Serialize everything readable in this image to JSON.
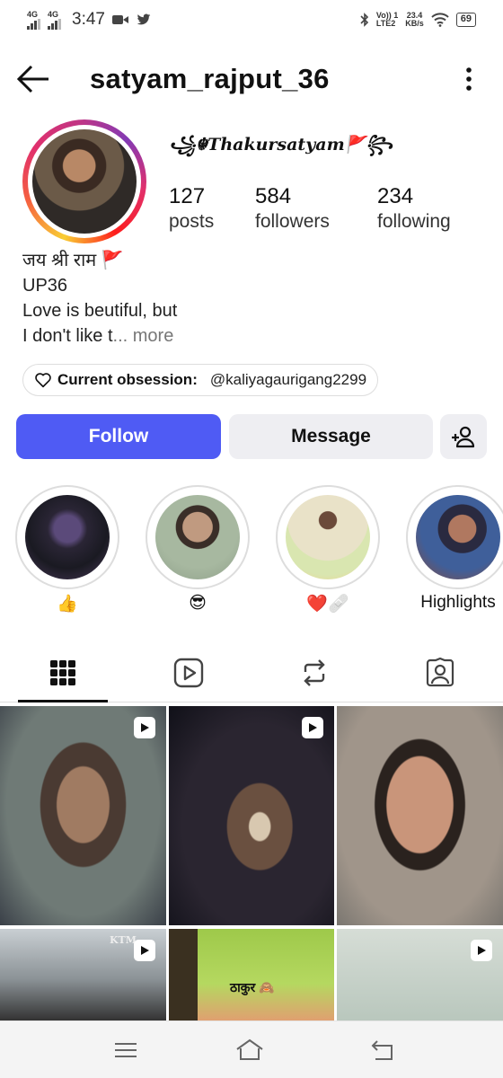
{
  "status_bar": {
    "net1": "4G",
    "net2": "4G",
    "time": "3:47",
    "volte": "Vo)) 1",
    "lte": "LTE2",
    "speed": "23.4",
    "speed_unit": "KB/s",
    "battery": "69"
  },
  "header": {
    "username": "satyam_rajput_36"
  },
  "profile": {
    "display_name": "꧁☬Thakursatyam🚩꧂",
    "stats": [
      {
        "value": "127",
        "label": "posts"
      },
      {
        "value": "584",
        "label": "followers"
      },
      {
        "value": "234",
        "label": "following"
      }
    ],
    "bio_lines": [
      "जय श्री राम 🚩",
      "UP36",
      "Love is beutiful, but",
      "I don't like t"
    ],
    "bio_ellipsis": "... more",
    "obsession_label": "Current obsession:",
    "obsession_handle": "@kaliyagaurigang2299"
  },
  "actions": {
    "follow": "Follow",
    "message": "Message"
  },
  "highlights": [
    {
      "caption": "👍"
    },
    {
      "caption": "😎"
    },
    {
      "caption": "❤️🩹"
    },
    {
      "caption": "Highlights"
    }
  ],
  "grid": {
    "cell_texts": [
      "KTM",
      "ठाकुर 🙈"
    ]
  },
  "icons": {
    "back": "back-arrow-icon",
    "more": "more-vertical-icon",
    "heart": "heart-icon",
    "add_user": "add-user-icon",
    "grid_tab": "grid-icon",
    "reels_tab": "reels-icon",
    "reposts_tab": "repost-icon",
    "tagged_tab": "tagged-icon"
  },
  "colors": {
    "follow_button": "#4f5bf4",
    "secondary_button": "#eeeef2"
  }
}
